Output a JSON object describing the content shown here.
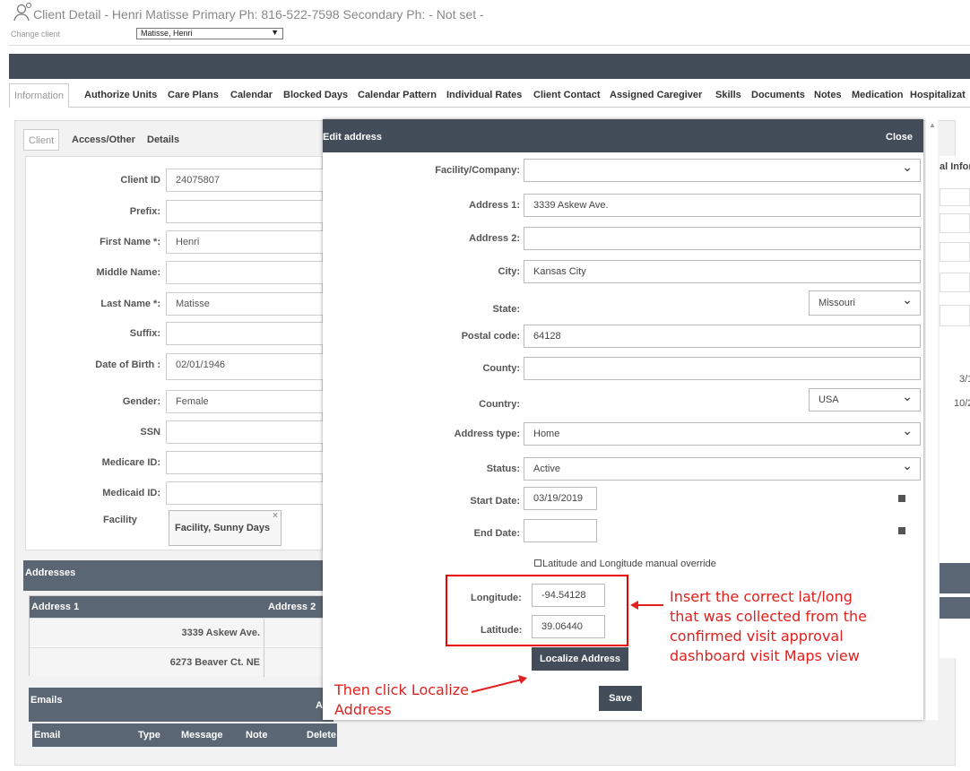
{
  "header": {
    "title": "Client Detail - Henri Matisse Primary Ph: 816-522-7598 Secondary Ph: - Not set -",
    "change_client_label": "Change client",
    "client_select_value": "Matisse, Henri"
  },
  "tabs": [
    "Information",
    "Authorize Units",
    "Care Plans",
    "Calendar",
    "Blocked Days",
    "Calendar Pattern",
    "Individual Rates",
    "Client Contact",
    "Assigned Caregiver",
    "Skills",
    "Documents",
    "Notes",
    "Medication",
    "Hospitalizat"
  ],
  "subtabs": [
    "Client",
    "Access/Other",
    "Details"
  ],
  "client_form": [
    {
      "label": "Client ID",
      "value": "24075807"
    },
    {
      "label": "Prefix:",
      "value": ""
    },
    {
      "label": "First Name *:",
      "value": "Henri"
    },
    {
      "label": "Middle Name:",
      "value": ""
    },
    {
      "label": "Last Name *:",
      "value": "Matisse"
    },
    {
      "label": "Suffix:",
      "value": ""
    },
    {
      "label": "Date of Birth :",
      "value": "02/01/1946"
    },
    {
      "label": "Gender:",
      "value": "Female"
    },
    {
      "label": "SSN",
      "value": ""
    },
    {
      "label": "Medicare ID:",
      "value": ""
    },
    {
      "label": "Medicaid ID:",
      "value": ""
    }
  ],
  "facility": {
    "label": "Facility",
    "chip": "Facility, Sunny Days",
    "remove": "×"
  },
  "addresses": {
    "section": "Addresses",
    "columns": [
      "Address 1",
      "Address 2"
    ],
    "rows": [
      "3339 Askew Ave.",
      "6273 Beaver Ct. NE"
    ]
  },
  "emails": {
    "section": "Emails",
    "section_right": "A",
    "columns": [
      "Email",
      "Type",
      "Message",
      "Note",
      "Delete"
    ]
  },
  "right_bg": {
    "info": "al Infor",
    "d1": "3/1",
    "d2": "10/2"
  },
  "modal": {
    "title": "Edit address",
    "close": "Close",
    "fields": [
      {
        "label": "Facility/Company:",
        "value": "",
        "select": true
      },
      {
        "label": "Address 1:",
        "value": "3339 Askew Ave."
      },
      {
        "label": "Address 2:",
        "value": ""
      },
      {
        "label": "City:",
        "value": "Kansas City"
      },
      {
        "label": "State:",
        "value": "Missouri",
        "select": true
      },
      {
        "label": "Postal code:",
        "value": "64128"
      },
      {
        "label": "County:",
        "value": ""
      },
      {
        "label": "Country:",
        "value": "USA",
        "select": true
      },
      {
        "label": "Address type:",
        "value": "Home",
        "select": true
      },
      {
        "label": "Status:",
        "value": "Active",
        "select": true
      },
      {
        "label": "Start Date:",
        "value": "03/19/2019"
      },
      {
        "label": "End Date:",
        "value": ""
      }
    ],
    "override_label": "Latitude and Longitude manual override",
    "longitude_label": "Longitude:",
    "longitude": "-94.54128",
    "latitude_label": "Latitude:",
    "latitude": "39.06440",
    "localize_button": "Localize Address",
    "save_button": "Save"
  },
  "annotations": {
    "right": [
      "Insert the correct lat/long",
      "that was collected from the",
      "confirmed visit approval",
      "dashboard visit Maps view"
    ],
    "left": [
      "Then click Localize",
      "Address"
    ],
    "color": "#e0201e"
  },
  "colors": {
    "header_dark": "#434d5a",
    "section_dark": "#5b6674"
  }
}
